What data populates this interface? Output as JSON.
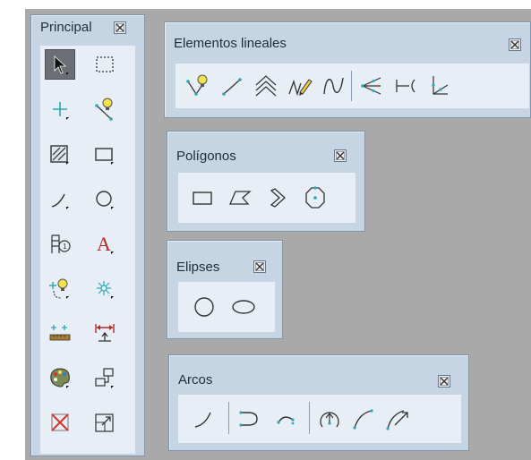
{
  "colors": {
    "palette_bg": "#c5d5e4",
    "tool_bg": "#e8eef5",
    "accent_yellow": "#f2e34c",
    "accent_teal": "#2aa7b5",
    "accent_red": "#b02a2a"
  },
  "principal": {
    "title": "Principal",
    "tools": [
      {
        "name": "select-arrow-icon",
        "selected": true
      },
      {
        "name": "select-rectangle-icon"
      },
      {
        "name": "point-icon"
      },
      {
        "name": "snap-line-bulb-icon"
      },
      {
        "name": "hatch-fill-icon"
      },
      {
        "name": "rectangle-icon"
      },
      {
        "name": "arc-curve-icon"
      },
      {
        "name": "circle-icon"
      },
      {
        "name": "dimension-block-icon"
      },
      {
        "name": "text-icon",
        "glyph": "A"
      },
      {
        "name": "bulb-snap-icon"
      },
      {
        "name": "star-point-icon"
      },
      {
        "name": "measure-ruler-icon"
      },
      {
        "name": "dimension-arrows-icon"
      },
      {
        "name": "paint-palette-icon"
      },
      {
        "name": "insert-block-icon"
      },
      {
        "name": "delete-cross-icon"
      },
      {
        "name": "scale-icon"
      }
    ]
  },
  "lineales": {
    "title": "Elementos lineales",
    "tools": [
      "bulb-line-icon",
      "line-segment-icon",
      "parallel-lines-icon",
      "freehand-pen-icon",
      "curve-wave-icon",
      "angle-lines-icon",
      "dimension-bracket-icon",
      "corner-line-icon"
    ]
  },
  "poligonos": {
    "title": "Polígonos",
    "tools": [
      "rectangle-polygon-icon",
      "irregular-polygon-icon",
      "rotated-square-icon",
      "octagon-icon"
    ]
  },
  "elipses": {
    "title": "Elipses",
    "tools": [
      "circle-ellipse-icon",
      "ellipse-icon"
    ]
  },
  "arcos": {
    "title": "Arcos",
    "tools": [
      "arc-simple-icon",
      "arc-bracket-icon",
      "arc-endpoints-icon",
      "arc-center-icon",
      "arc-three-point-icon",
      "arc-tangent-icon"
    ]
  }
}
